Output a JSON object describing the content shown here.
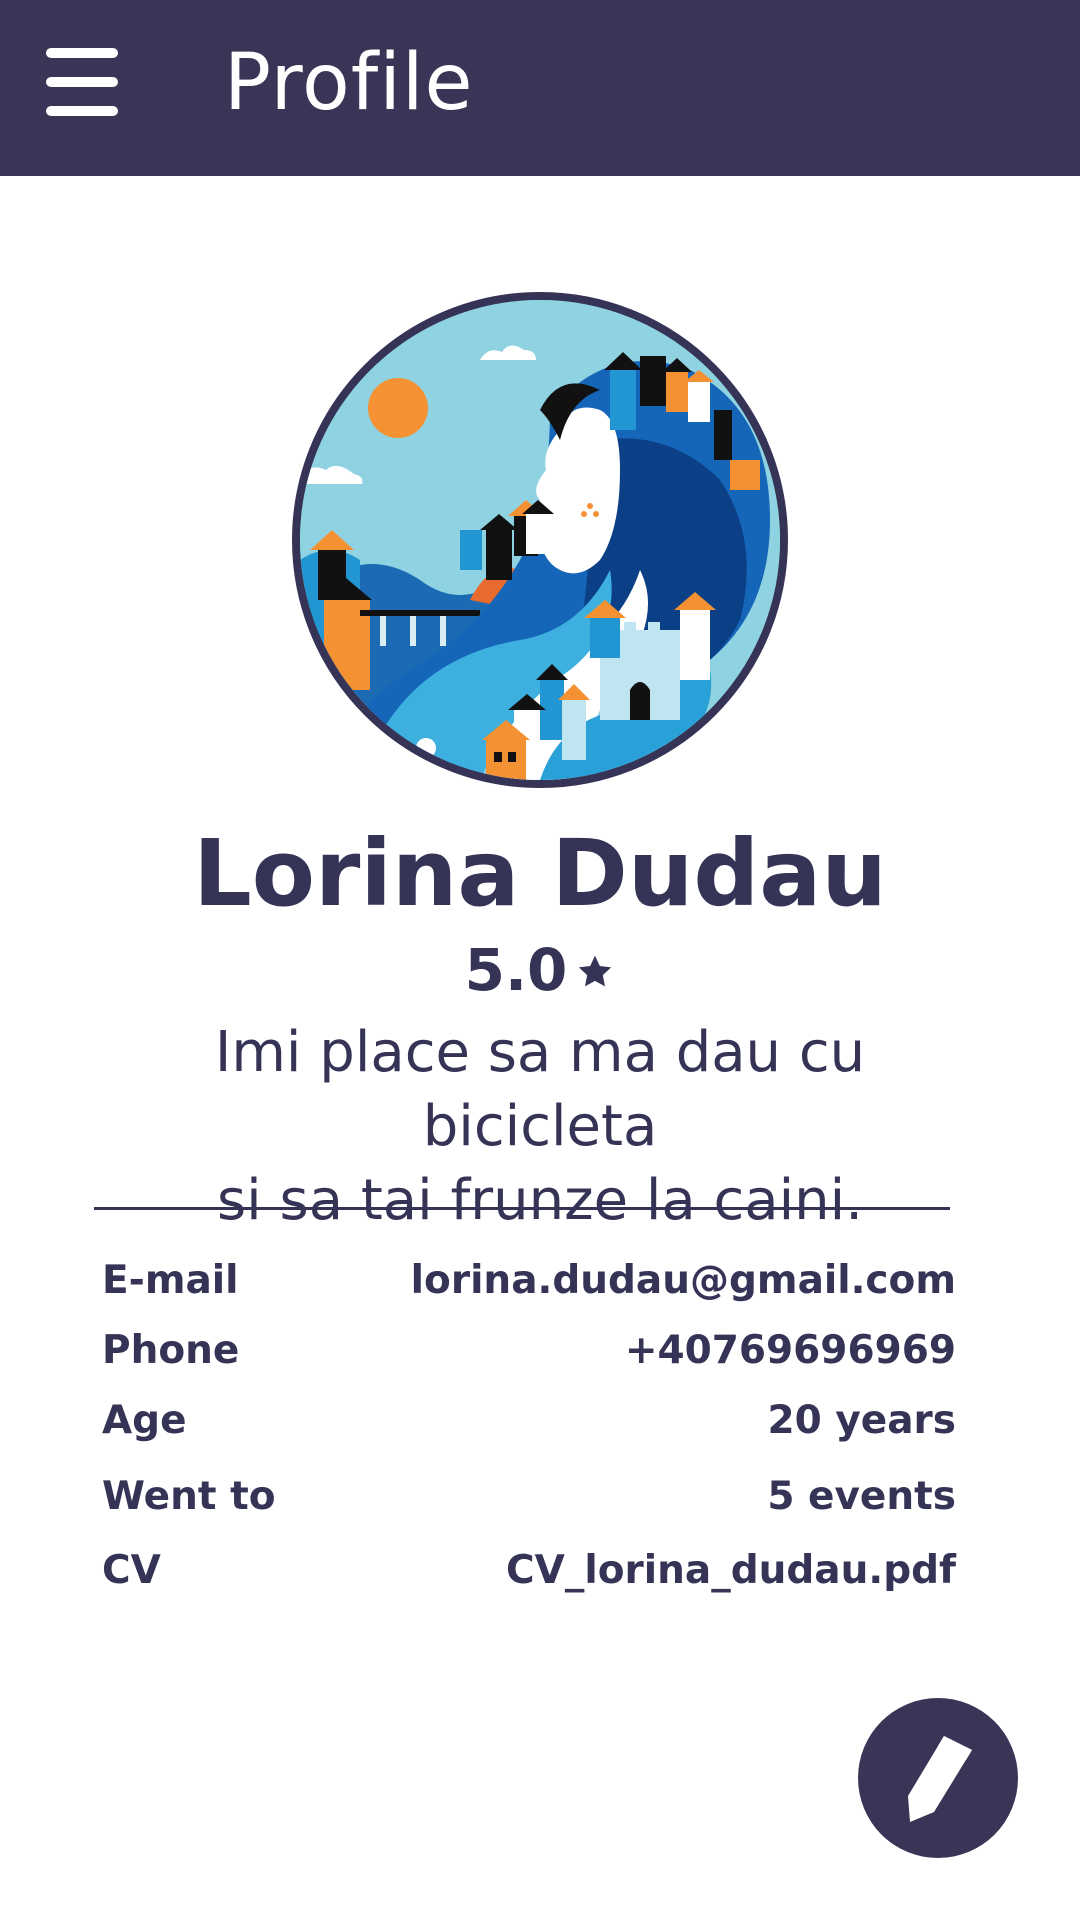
{
  "app_bar": {
    "title": "Profile",
    "menu_icon": "hamburger-menu-icon",
    "background": "#383556"
  },
  "profile": {
    "name": "Lorina Dudau",
    "rating": "5.0",
    "rating_icon": "star-icon",
    "bio_line1": "Imi place sa ma dau cu bicicleta",
    "bio_line2": "si sa tai frunze la caini.",
    "accent_color": "#363456"
  },
  "details": [
    {
      "label": "E-mail",
      "value": "lorina.dudau@gmail.com"
    },
    {
      "label": "Phone",
      "value": "+40769696969"
    },
    {
      "label": "Age",
      "value": "20 years"
    },
    {
      "label": "Went to",
      "value": "5 events"
    },
    {
      "label": "CV",
      "value": "CV_lorina_dudau.pdf"
    }
  ],
  "fab": {
    "icon": "pencil-edit-icon"
  }
}
